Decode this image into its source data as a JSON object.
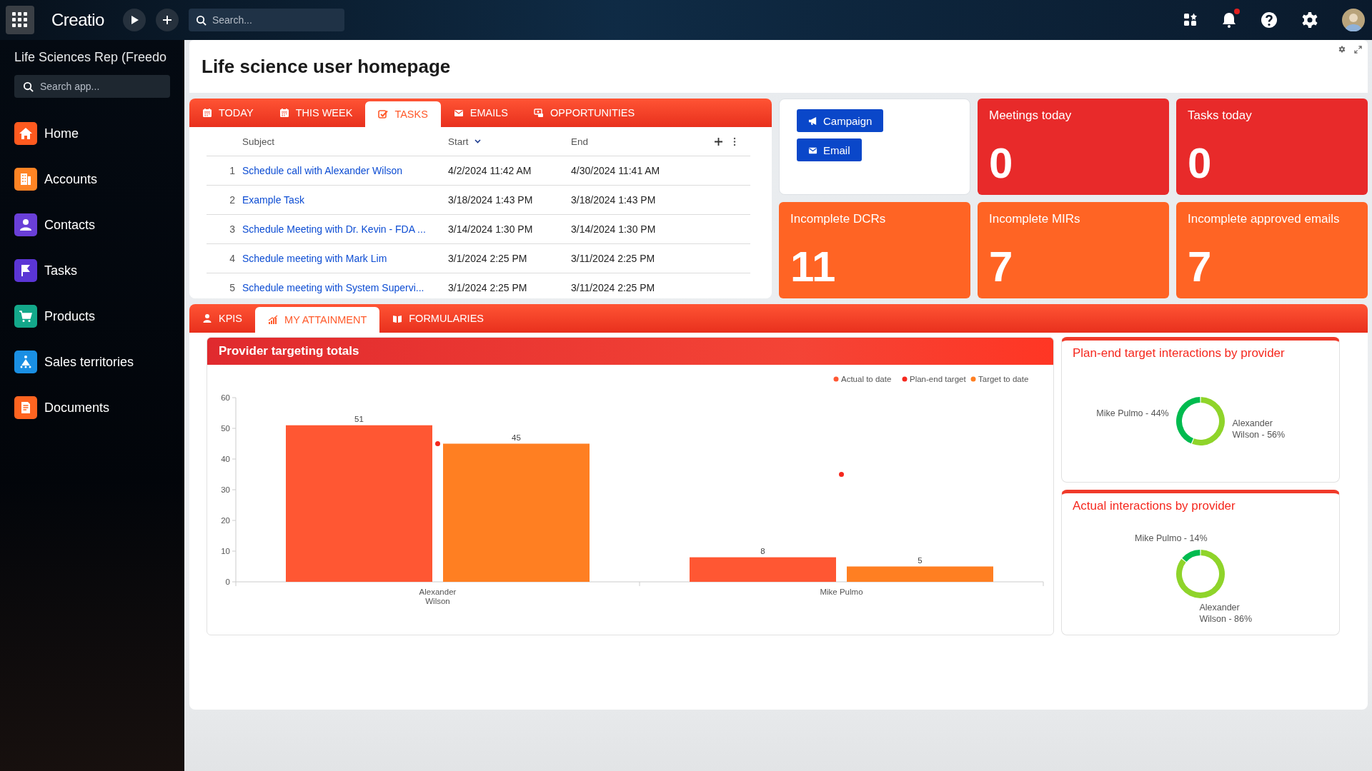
{
  "topbar": {
    "logo": "Creatio",
    "search": {
      "placeholder": "Search..."
    },
    "has_notifications": true
  },
  "sidebar": {
    "title": "Life Sciences Rep (Freedo",
    "search": {
      "placeholder": "Search app..."
    },
    "items": [
      {
        "label": "Home",
        "kind": "home",
        "color": "#ff5a1f"
      },
      {
        "label": "Accounts",
        "kind": "building",
        "color": "#ff8424"
      },
      {
        "label": "Contacts",
        "kind": "person",
        "color": "#6a3fd8"
      },
      {
        "label": "Tasks",
        "kind": "flag",
        "color": "#5b35d5"
      },
      {
        "label": "Products",
        "kind": "cart",
        "color": "#13a88a"
      },
      {
        "label": "Sales territories",
        "kind": "tree",
        "color": "#1a8fe3"
      },
      {
        "label": "Documents",
        "kind": "document",
        "color": "#ff6420"
      }
    ]
  },
  "page": {
    "title": "Life science user homepage"
  },
  "activity_tabs": [
    {
      "label": "TODAY",
      "kind": "calendar",
      "selected": false
    },
    {
      "label": "THIS WEEK",
      "kind": "calendar",
      "selected": false
    },
    {
      "label": "TASKS",
      "kind": "check",
      "selected": true
    },
    {
      "label": "EMAILS",
      "kind": "mail",
      "selected": false
    },
    {
      "label": "OPPORTUNITIES",
      "kind": "money",
      "selected": false
    }
  ],
  "tasks_table": {
    "columns": [
      {
        "label": "Subject",
        "sorted": false
      },
      {
        "label": "Start",
        "sorted": true
      },
      {
        "label": "End",
        "sorted": false
      }
    ],
    "rows": [
      {
        "number": "1",
        "subject": "Schedule call with Alexander Wilson",
        "start": "4/2/2024 11:42 AM",
        "end": "4/30/2024 11:41 AM"
      },
      {
        "number": "2",
        "subject": "Example Task",
        "start": "3/18/2024 1:43 PM",
        "end": "3/18/2024 1:43 PM"
      },
      {
        "number": "3",
        "subject": "Schedule Meeting with Dr. Kevin - FDA ...",
        "start": "3/14/2024 1:30 PM",
        "end": "3/14/2024 1:30 PM"
      },
      {
        "number": "4",
        "subject": "Schedule meeting with Mark Lim",
        "start": "3/1/2024 2:25 PM",
        "end": "3/11/2024 2:25 PM"
      },
      {
        "number": "5",
        "subject": "Schedule meeting with System Supervi...",
        "start": "3/1/2024 2:25 PM",
        "end": "3/11/2024 2:25 PM"
      }
    ]
  },
  "actions": [
    {
      "label": "Campaign",
      "kind": "megaphone"
    },
    {
      "label": "Email",
      "kind": "mail"
    }
  ],
  "tiles": [
    {
      "title": "Meetings today",
      "value": "0",
      "color": "#e82a2a"
    },
    {
      "title": "Tasks today",
      "value": "0",
      "color": "#e82a2a"
    },
    {
      "title": "Incomplete DCRs",
      "value": "11",
      "color": "#ff6424"
    },
    {
      "title": "Incomplete MIRs",
      "value": "7",
      "color": "#ff6424"
    },
    {
      "title": "Incomplete approved emails",
      "value": "7",
      "color": "#ff6424"
    }
  ],
  "dashboard_tabs": [
    {
      "label": "KPIS",
      "kind": "person",
      "selected": false
    },
    {
      "label": "MY ATTAINMENT",
      "kind": "chart",
      "selected": true
    },
    {
      "label": "FORMULARIES",
      "kind": "book",
      "selected": false
    }
  ],
  "provider_chart": {
    "title": "Provider targeting totals",
    "chart_data": {
      "type": "bar",
      "categories": [
        "Alexander Wilson",
        "Mike Pulmo"
      ],
      "series": [
        {
          "name": "Actual to date",
          "color": "#ff5733",
          "type": "bar",
          "values": [
            51,
            8
          ]
        },
        {
          "name": "Plan-end target",
          "color": "#f5281e",
          "type": "scatter",
          "values": [
            45,
            35
          ]
        },
        {
          "name": "Target to date",
          "color": "#ff7f22",
          "type": "bar",
          "values": [
            45,
            5
          ]
        }
      ],
      "ylim": [
        0,
        60
      ],
      "yticks": [
        0,
        10,
        20,
        30,
        40,
        50,
        60
      ],
      "value_labels": [
        [
          "51",
          "8"
        ],
        null,
        [
          "45",
          "5"
        ]
      ],
      "legend": "top-right"
    }
  },
  "donut_charts": [
    {
      "title": "Plan-end target interactions by provider",
      "chart_data": {
        "type": "donut",
        "categories": [
          "Alexander Wilson - 56%",
          "Mike Pulmo - 44%"
        ],
        "values": [
          56,
          44
        ],
        "colors": [
          "#8fd42a",
          "#00bb4f"
        ]
      }
    },
    {
      "title": "Actual interactions by provider",
      "chart_data": {
        "type": "donut",
        "categories": [
          "Alexander Wilson - 86%",
          "Mike Pulmo - 14%"
        ],
        "values": [
          86,
          14
        ],
        "colors": [
          "#8fd42a",
          "#00bb4f"
        ]
      }
    }
  ]
}
